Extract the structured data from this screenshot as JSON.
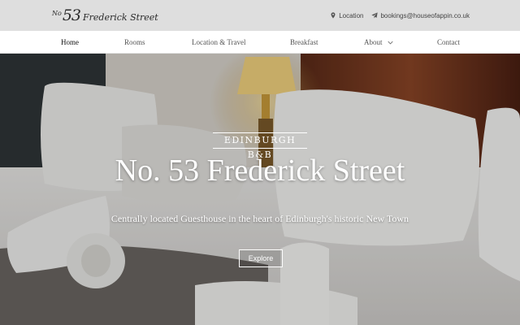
{
  "header": {
    "logo_prefix": "No",
    "logo_number": "53",
    "logo_street": "Frederick Street",
    "location_label": "Location",
    "email": "bookings@houseofappin.co.uk"
  },
  "nav": {
    "items": [
      {
        "label": "Home"
      },
      {
        "label": "Rooms"
      },
      {
        "label": "Location & Travel"
      },
      {
        "label": "Breakfast"
      },
      {
        "label": "About"
      },
      {
        "label": "Contact"
      }
    ]
  },
  "hero": {
    "tag": "EDINBURGH B&B",
    "title": "No. 53 Frederick Street",
    "subtitle": "Centrally located Guesthouse in the heart of Edinburgh's historic New Town",
    "button_label": "Explore"
  },
  "colors": {
    "topbar": "#dedede",
    "nav_bg": "#ffffff",
    "hero_text": "#ffffff"
  }
}
